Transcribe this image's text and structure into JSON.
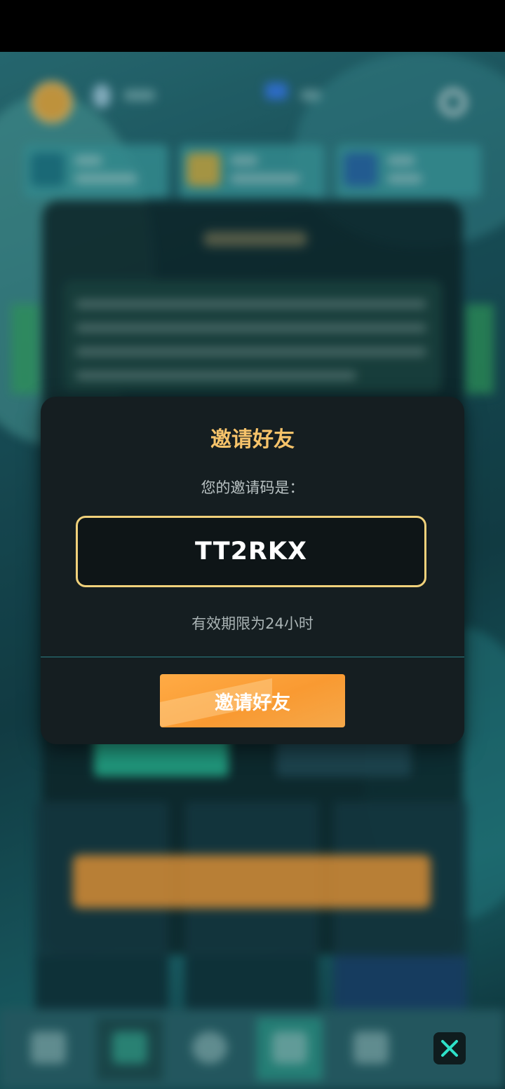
{
  "dialog": {
    "title": "邀请好友",
    "code_prompt": "您的邀请码是：",
    "invite_code": "TT2RKX",
    "validity_text": "有效期限为24小时",
    "invite_button_label": "邀请好友"
  },
  "icons": {
    "close": "close-icon",
    "settings": "gear-icon",
    "currency": "coin-icon"
  },
  "colors": {
    "dialog_bg": "#151e21",
    "title_gold": "#f6c36a",
    "code_border": "#f0d17b",
    "button_orange": "#f99a32",
    "divider_teal": "#2a7f86"
  }
}
